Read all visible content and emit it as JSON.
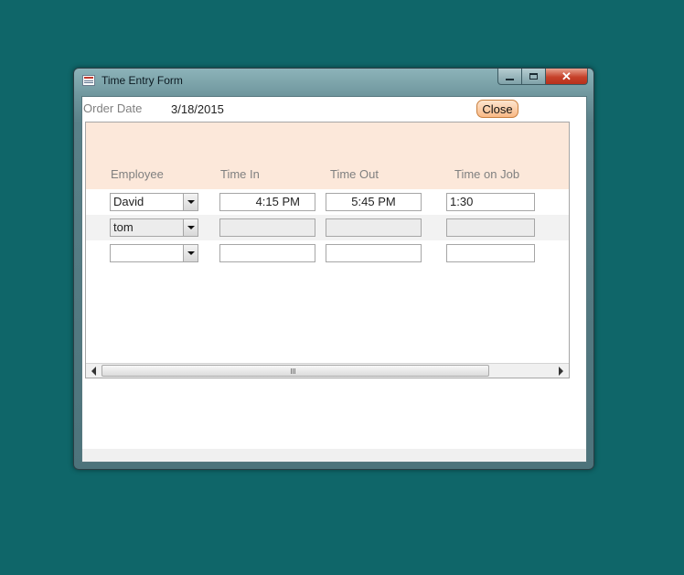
{
  "window": {
    "title": "Time Entry Form",
    "controls": {
      "minimize": "minimize-icon",
      "maximize": "maximize-icon",
      "close": "✕"
    }
  },
  "form": {
    "order_date_label": "Order Date",
    "order_date_value": "3/18/2015",
    "close_button": "Close"
  },
  "subform": {
    "columns": [
      "Employee",
      "Time In",
      "Time Out",
      "Time on Job"
    ],
    "rows": [
      {
        "employee": "David",
        "time_in": "4:15 PM",
        "time_out": "5:45 PM",
        "time_on_job": "1:30"
      },
      {
        "employee": "tom",
        "time_in": "",
        "time_out": "",
        "time_on_job": ""
      },
      {
        "employee": "",
        "time_in": "",
        "time_out": "",
        "time_on_job": ""
      }
    ]
  },
  "colors": {
    "desktop": "#0f6669",
    "header_band": "#fce8da",
    "close_button": "#f9b986",
    "window_close": "#c6412a"
  }
}
